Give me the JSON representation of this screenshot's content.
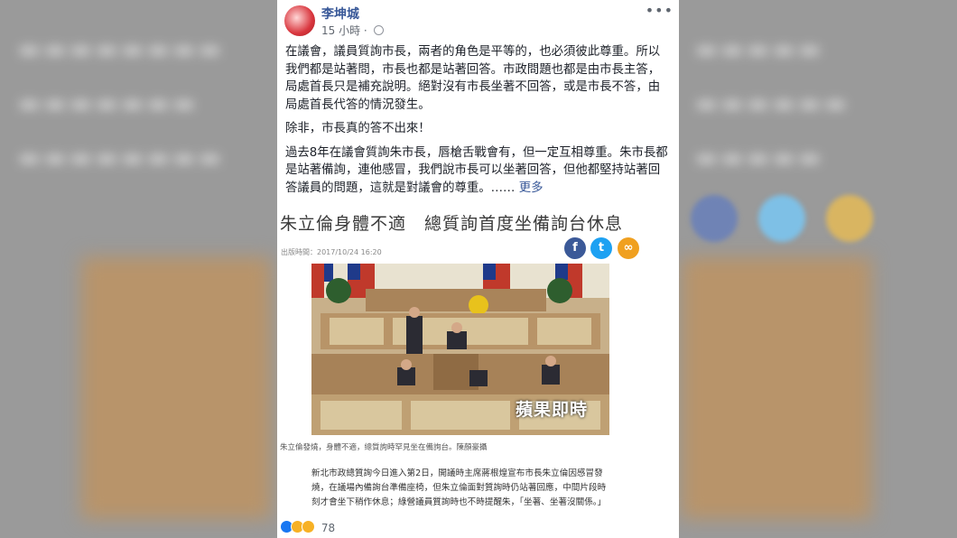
{
  "post": {
    "author": "李坤城",
    "time": "15 小時",
    "more": "•••",
    "paragraphs": [
      "在議會，議員質詢市長，兩者的角色是平等的，也必須彼此尊重。所以我們都是站著問，市長也都是站著回答。市政問題也都是由市長主答，局處首長只是補充說明。絕對沒有市長坐著不回答，或是市長不答，由局處首長代答的情況發生。",
      "除非，市長真的答不出來！",
      "過去8年在議會質詢朱市長，唇槍舌戰會有，但一定互相尊重。朱市長都是站著備詢，連他感冒，我們說市長可以坐著回答，但他都堅持站著回答議員的問題，這就是對議會的尊重。……"
    ],
    "see_more": "更多"
  },
  "article": {
    "title": "朱立倫身體不適　總質詢首度坐備詢台休息",
    "date": "出版時間：2017/10/24 16:20",
    "share_icons": [
      "facebook-icon",
      "twitter-icon",
      "link-icon"
    ],
    "watermark": "蘋果即時",
    "caption": "朱立倫發燒，身體不適，總質詢時罕見坐在備詢台。陳顏豪攝",
    "body": "新北市政總質詢今日進入第2日，開議時主席蔣根煌宣布市長朱立倫因感冒發燒，在議場內備詢台準備座椅，但朱立倫面對質詢時仍站著回應，中間片段時刻才會坐下稍作休息；綠營議員質詢時也不時提醒朱，「坐著、坐著沒關係。」"
  },
  "reactions": {
    "count": "78",
    "icons": [
      "like-icon",
      "haha-icon",
      "wow-icon"
    ]
  },
  "colors": {
    "link": "#385898",
    "facebook": "#3b5998",
    "twitter": "#1da1f2",
    "link_share": "#f0a020"
  }
}
